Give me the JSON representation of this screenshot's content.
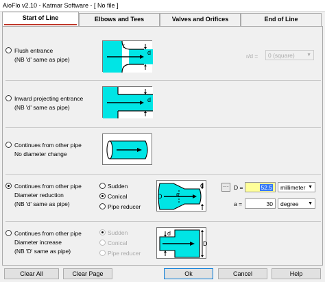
{
  "window": {
    "title": "AioFlo  v2.10  -  Katmar Software  -  [ No file ]"
  },
  "tabs": [
    {
      "label": "Start of Line",
      "active": true
    },
    {
      "label": "Elbows and Tees",
      "active": false
    },
    {
      "label": "Valves and Orifices",
      "active": false
    },
    {
      "label": "End of Line",
      "active": false
    }
  ],
  "options": [
    {
      "line1": "Flush entrance",
      "line2": "(NB 'd' same as pipe)",
      "selected": false
    },
    {
      "line1": "Inward projecting entrance",
      "line2": "(NB 'd' same as pipe)",
      "selected": false
    },
    {
      "line1": "Continues from other pipe",
      "line2": "No diameter change",
      "selected": false
    },
    {
      "line1": "Continues from other pipe",
      "line2": "Diameter reduction",
      "line3": "(NB 'd' same as pipe)",
      "selected": true
    },
    {
      "line1": "Continues from other pipe",
      "line2": "Diameter increase",
      "line3": "(NB 'D' same as pipe)",
      "selected": false
    }
  ],
  "diagram_labels": {
    "r": "r",
    "d": "d",
    "D": "D",
    "a": "a"
  },
  "flush": {
    "rd_label": "r/d =",
    "rd_value": "0  (square)"
  },
  "reduction": {
    "choices": [
      {
        "label": "Sudden",
        "selected": false
      },
      {
        "label": "Conical",
        "selected": true
      },
      {
        "label": "Pipe reducer",
        "selected": false
      }
    ],
    "more_button": "···",
    "D_label": "D =",
    "D_value": "52.5",
    "D_unit": "millimeter",
    "a_label": "a =",
    "a_value": "30",
    "a_unit": "degree"
  },
  "increase": {
    "choices": [
      {
        "label": "Sudden",
        "selected": true
      },
      {
        "label": "Conical",
        "selected": false
      },
      {
        "label": "Pipe reducer",
        "selected": false
      }
    ]
  },
  "buttons": {
    "clear_all": "Clear All",
    "clear_page": "Clear Page",
    "ok": "Ok",
    "cancel": "Cancel",
    "help": "Help"
  },
  "colors": {
    "fluid": "#00e5e5",
    "tab_underline": "#c0392b",
    "highlight_input": "#ffff99",
    "selection": "#3478f6"
  }
}
